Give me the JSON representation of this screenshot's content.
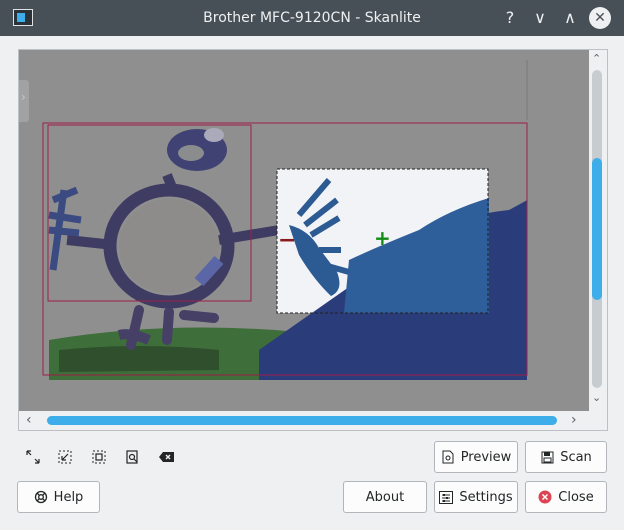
{
  "window": {
    "title": "Brother MFC-9120CN - Skanlite",
    "help_glyph": "?",
    "minimize_glyph": "∨",
    "maximize_glyph": "∧",
    "close_glyph": "✕"
  },
  "preview": {
    "remove_selection_glyph": "−",
    "add_selection_glyph": "+"
  },
  "scrollbars": {
    "up": "⌃",
    "down": "⌄",
    "left": "‹",
    "right": "›"
  },
  "toolbar": {
    "icons": [
      "zoom-in-icon",
      "zoom-out-icon",
      "zoom-selection-icon",
      "zoom-fit-icon",
      "clear-selection-icon"
    ]
  },
  "buttons": {
    "preview": "Preview",
    "scan": "Scan",
    "help": "Help",
    "about": "About",
    "settings": "Settings",
    "close": "Close"
  },
  "colors": {
    "titlebar": "#475057",
    "accent": "#3daee9",
    "selection_border": "#9c1f4a",
    "remove_mark": "#8b1a1a",
    "add_mark": "#128b12",
    "close_icon": "#da4453"
  }
}
